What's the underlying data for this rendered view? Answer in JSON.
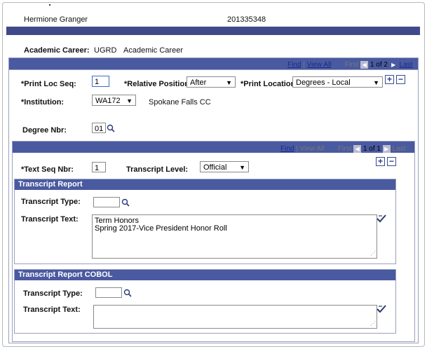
{
  "header": {
    "name": "Hermione Granger",
    "id": "201335348"
  },
  "career": {
    "label": "Academic Career:",
    "code": "UGRD",
    "desc": "Academic Career"
  },
  "outer_nav": {
    "find": "Find",
    "sep": "|",
    "view_all": "View All",
    "first": "First",
    "count": "1 of 2",
    "last": "Last"
  },
  "fields": {
    "print_loc_seq_label": "*Print Loc Seq:",
    "print_loc_seq_value": "1",
    "relative_position_label": "*Relative Position:",
    "relative_position_value": "After",
    "print_location_label": "*Print Location:",
    "print_location_value": "Degrees - Local",
    "institution_label": "*Institution:",
    "institution_value": "WA172",
    "institution_desc": "Spokane Falls CC",
    "degree_nbr_label": "Degree Nbr:",
    "degree_nbr_value": "01"
  },
  "inner_nav": {
    "find": "Find",
    "sep": "|",
    "view_all": "View All",
    "first": "First",
    "count": "1 of 1",
    "last": "Last"
  },
  "text_seq": {
    "label": "*Text Seq Nbr:",
    "value": "1",
    "transcript_level_label": "Transcript Level:",
    "transcript_level_value": "Official"
  },
  "transcript_report": {
    "title": "Transcript Report",
    "type_label": "Transcript Type:",
    "type_value": "",
    "text_label": "Transcript Text:",
    "text_line1": "Term Honors",
    "text_line2": "Spring 2017-Vice President Honor Roll"
  },
  "transcript_report_cobol": {
    "title": "Transcript Report COBOL",
    "type_label": "Transcript Type:",
    "type_value": "",
    "text_label": "Transcript Text:",
    "text_value": ""
  },
  "icons": {
    "plus": "+",
    "minus": "−",
    "dropdown_arrow": "▼",
    "prev_arrow": "◀",
    "next_arrow": "▶",
    "resize_grip": "⋰"
  },
  "colors": {
    "header_bar": "#404a8a",
    "section_header": "#4a5aa0",
    "link": "#1a2a8a"
  }
}
